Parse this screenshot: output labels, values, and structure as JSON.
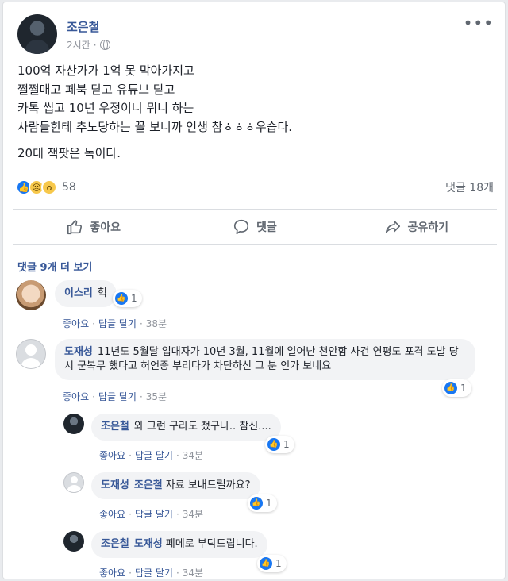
{
  "post": {
    "author": "조은철",
    "time": "2시간",
    "separator": "·",
    "more": "•••",
    "lines": [
      "100억 자산가가 1억 못 막아가지고",
      "쩔쩔매고 페북 닫고 유튜브 닫고",
      "카톡 씹고 10년 우정이니 뭐니 하는",
      "사람들한테 추노당하는 꼴 보니까 인생 참ㅎㅎㅎ우습다."
    ],
    "line_last": "20대 잭팟은 독이다.",
    "reaction_count": "58",
    "comment_count": "댓글 18개"
  },
  "actions": {
    "like": "좋아요",
    "comment": "댓글",
    "share": "공유하기"
  },
  "comments_section": {
    "more_label": "댓글 9개 더 보기",
    "like_label": "좋아요",
    "reply_label": "답글 달기",
    "dot": "·",
    "items": [
      {
        "name": "이스리",
        "text": "헉",
        "likes": "1",
        "time": "38분"
      },
      {
        "name": "도재성",
        "text": "11년도 5월달 입대자가 10년 3월, 11월에 일어난 천안함 사건 연평도 포격 도발 당시 군복무 했다고 허언증 부리다가 차단하신 그 분 인가 보네요",
        "likes": "1",
        "time": "35분"
      }
    ],
    "replies": [
      {
        "name": "조은철",
        "mention": "",
        "text": "와 그런 구라도 쳤구나.. 참신....",
        "likes": "1",
        "time": "34분"
      },
      {
        "name": "도재성",
        "mention": "조은철",
        "text": "자료 보내드릴까요?",
        "likes": "1",
        "time": "34분"
      },
      {
        "name": "조은철",
        "mention": "도재성",
        "text": "페메로 부탁드립니다.",
        "likes": "1",
        "time": "34분"
      }
    ]
  },
  "colors": {
    "link_blue": "#385898",
    "like_blue": "#1877f2",
    "meta_gray": "#90949c",
    "bubble_bg": "#f2f3f5"
  },
  "icons": [
    "globe-icon",
    "like-thumb-icon",
    "comment-icon",
    "share-icon",
    "like-reaction-icon",
    "sad-reaction-icon",
    "wow-reaction-icon"
  ]
}
